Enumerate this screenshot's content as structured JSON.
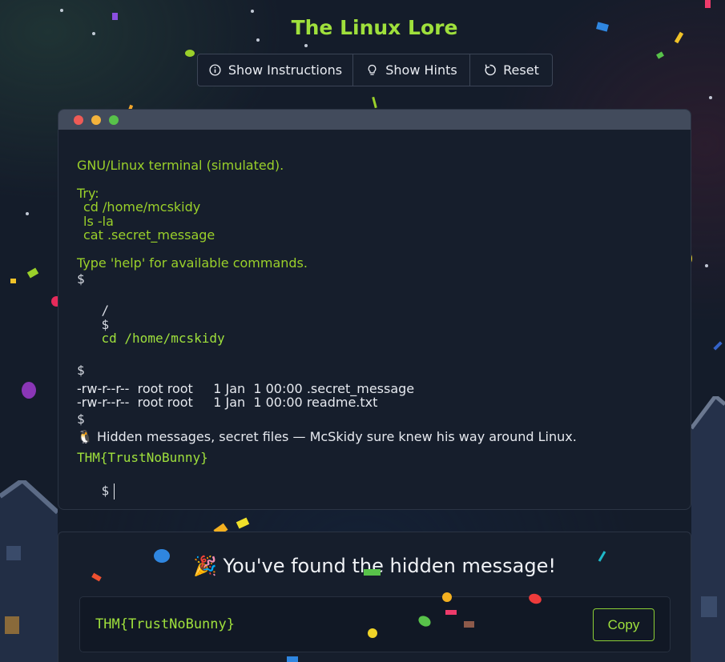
{
  "app": {
    "title": "The Linux Lore"
  },
  "toolbar": {
    "instructions_label": "Show Instructions",
    "hints_label": "Show Hints",
    "reset_label": "Reset"
  },
  "terminal": {
    "intro": "GNU/Linux terminal (simulated).",
    "try_label": "Try:",
    "try_cmds": [
      "cd /home/mcskidy",
      "ls -la",
      "cat .secret_message"
    ],
    "help_text": "Type 'help' for available commands.",
    "prompt": "$",
    "cwd": "/",
    "command": "cd /home/mcskidy",
    "listing": [
      "-rw-r--r--  root root     1 Jan  1 00:00 .secret_message",
      "-rw-r--r--  root root     1 Jan  1 00:00 readme.txt"
    ],
    "message": "🐧 Hidden messages, secret files — McSkidy sure knew his way around Linux.",
    "flag": "THM{TrustNoBunny}"
  },
  "result": {
    "heading": "🎉 You've found the hidden message!",
    "flag": "THM{TrustNoBunny}",
    "copy_label": "Copy"
  },
  "colors": {
    "accent": "#9fe03c",
    "background": "#141c2a",
    "panel": "#161e2c",
    "dot_red": "#ee5b56",
    "dot_yellow": "#f3b33c",
    "dot_green": "#58c24a"
  }
}
